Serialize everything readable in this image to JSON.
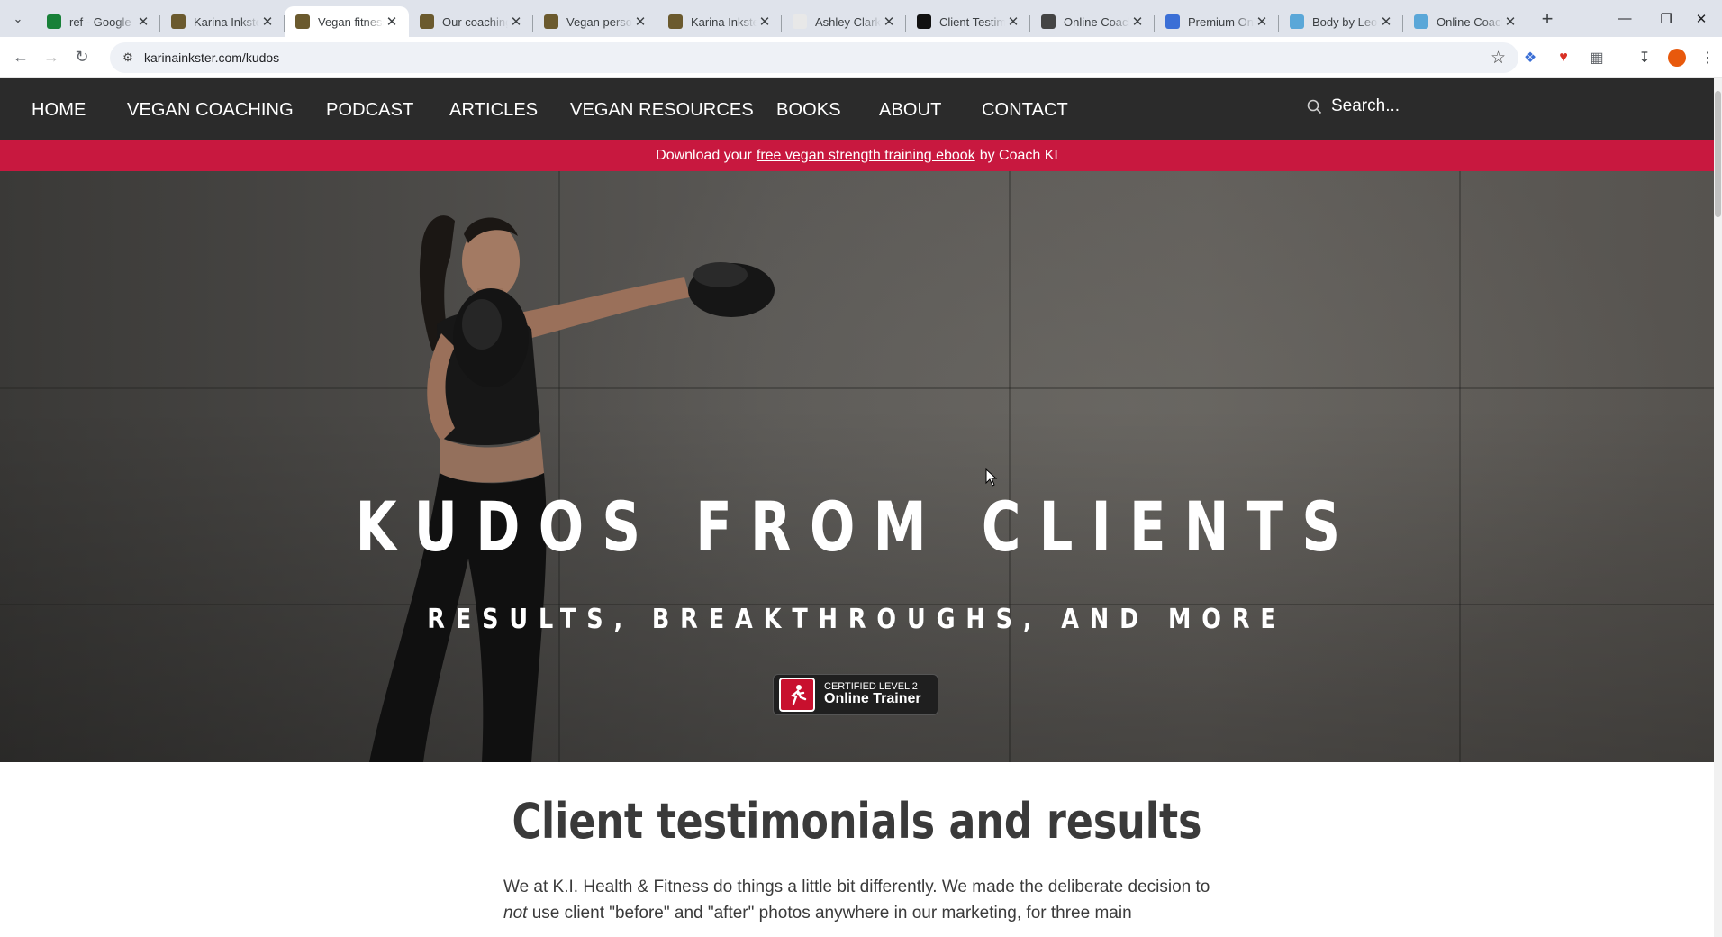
{
  "browser": {
    "tabs": [
      {
        "title": "ref - Google Sheets",
        "favicon_color": "#188038",
        "active": false
      },
      {
        "title": "Karina Inkster",
        "favicon_color": "#6b5a2e",
        "active": false
      },
      {
        "title": "Vegan fitness",
        "favicon_color": "#6b5a2e",
        "active": true
      },
      {
        "title": "Our coaching",
        "favicon_color": "#6b5a2e",
        "active": false
      },
      {
        "title": "Vegan personal",
        "favicon_color": "#6b5a2e",
        "active": false
      },
      {
        "title": "Karina Inkster",
        "favicon_color": "#6b5a2e",
        "active": false
      },
      {
        "title": "Ashley Clark",
        "favicon_color": "#e8e8e8",
        "active": false
      },
      {
        "title": "Client Testim",
        "favicon_color": "#111111",
        "active": false
      },
      {
        "title": "Online Coach",
        "favicon_color": "#444444",
        "active": false
      },
      {
        "title": "Premium On",
        "favicon_color": "#3b6fd6",
        "active": false
      },
      {
        "title": "Body by Leo",
        "favicon_color": "#5aa7d8",
        "active": false
      },
      {
        "title": "Online Coach",
        "favicon_color": "#5aa7d8",
        "active": false
      }
    ],
    "url": "karinainkster.com/kudos"
  },
  "site": {
    "nav": [
      "HOME",
      "VEGAN COACHING",
      "PODCAST",
      "ARTICLES",
      "VEGAN RESOURCES",
      "BOOKS",
      "ABOUT",
      "CONTACT"
    ],
    "search_placeholder": "Search...",
    "promo": {
      "before": "Download your",
      "link": "free vegan strength training ebook",
      "after": "by Coach KI"
    },
    "hero": {
      "title": "KUDOS FROM CLIENTS",
      "subtitle": "RESULTS, BREAKTHROUGHS, AND MORE",
      "badge_small": "CERTIFIED LEVEL 2",
      "badge_big": "Online Trainer"
    },
    "section_title": "Client testimonials and results",
    "intro": {
      "part1": "We at K.I. Health & Fitness do things a little bit differently. We made the deliberate decision to ",
      "em": "not",
      "part2": " use client \"before\" and \"after\" photos anywhere in our marketing, for three main"
    }
  },
  "colors": {
    "nav_bg": "#2b2b2b",
    "promo_bg": "#c8183f",
    "accent_badge": "#c8102e"
  }
}
